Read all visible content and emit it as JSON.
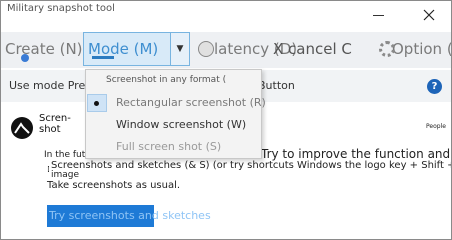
{
  "window": {
    "title": "Military snapshot tool"
  },
  "toolbar": {
    "create_label": "Create (N)",
    "mode_label": "Mode (M)",
    "delay_label": "latency (D)",
    "cancel_label": "X cancel C",
    "options_label": "Option (O)"
  },
  "info": {
    "left_text": "Use mode Press",
    "right_text": "Button",
    "help_glyph": "?"
  },
  "menu": {
    "header": "Screenshot in any format (",
    "items": [
      {
        "label": "Rectangular screenshot (R)",
        "selected": true
      },
      {
        "label": "Window screenshot (W)",
        "selected": false
      },
      {
        "label": "Full screen shot (S)",
        "selected": false
      }
    ]
  },
  "content": {
    "logo_text": "Scren- shot",
    "people": "People",
    "in_future": "In the future",
    "try_improve": "Try to improve the function and use",
    "shortcut_text": "Screenshots and sketches (& S) (or try shortcuts Windows the logo key + Shift + S)",
    "image_word": "image",
    "take_text": "Take screenshots as usual.",
    "try_button": "Try screenshots and sketches"
  },
  "colors": {
    "accent": "#1e7ad6",
    "mode_selected": "#d8eaf8",
    "help_blue": "#1d64b8"
  },
  "icons": {
    "create": "new-snip-icon",
    "mode": "rectangle-mode-icon",
    "delay": "clock-icon",
    "options": "gear-icon",
    "close": "close-icon",
    "minimize": "minimize-icon",
    "help": "help-icon",
    "logo": "snipping-tool-logo-icon"
  }
}
